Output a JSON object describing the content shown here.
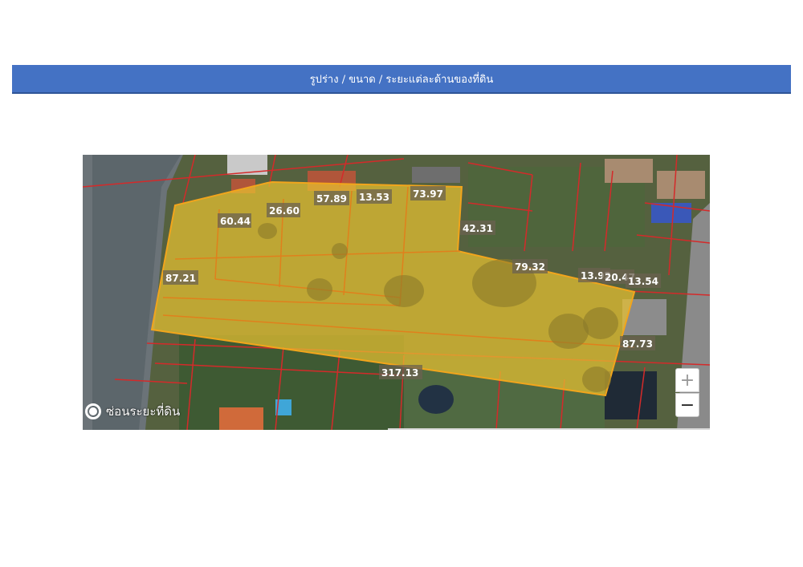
{
  "header": {
    "title": "รูปร่าง / ขนาด / ระยะแต่ละด้านของที่ดิน"
  },
  "map": {
    "dimension_labels": [
      "60.44",
      "26.60",
      "57.89",
      "13.53",
      "73.97",
      "42.31",
      "87.21",
      "79.32",
      "13.92",
      "20.47",
      "13.54",
      "87.73",
      "317.13"
    ],
    "toggle_label": "ซ่อนระยะที่ดิน",
    "zoom_in_label": "+",
    "zoom_out_label": "−",
    "colors": {
      "parcel_fill": "#e8c030",
      "parcel_outline": "#f2a51c",
      "plot_lines": "#e03030",
      "canal": "#5f6a6f"
    }
  }
}
